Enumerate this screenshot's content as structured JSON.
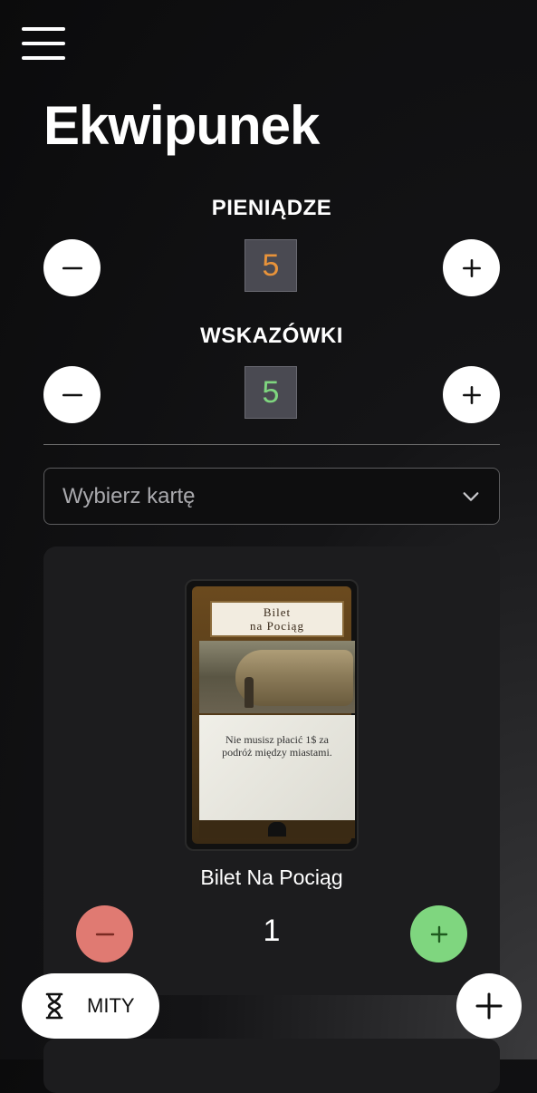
{
  "header": {
    "title": "Ekwipunek"
  },
  "money": {
    "label": "PIENIĄDZE",
    "value": "5",
    "value_color": "#e8933a"
  },
  "clues": {
    "label": "WSKAZÓWKI",
    "value": "5",
    "value_color": "#7fd67f"
  },
  "card_select": {
    "placeholder": "Wybierz kartę"
  },
  "cards": [
    {
      "name": "Bilet Na Pociąg",
      "image_title_line1": "Bilet",
      "image_title_line2": "na Pociąg",
      "image_text": "Nie musisz płacić 1$ za podróż między miastami.",
      "quantity": "1"
    }
  ],
  "bottom_bar": {
    "myths_label": "MITY"
  },
  "icons": {
    "menu": "menu-icon",
    "minus": "minus-icon",
    "plus": "plus-icon",
    "chevron": "chevron-down-icon",
    "hourglass": "hourglass-icon"
  },
  "colors": {
    "decrement": "#e07a72",
    "increment": "#7fd67f"
  }
}
